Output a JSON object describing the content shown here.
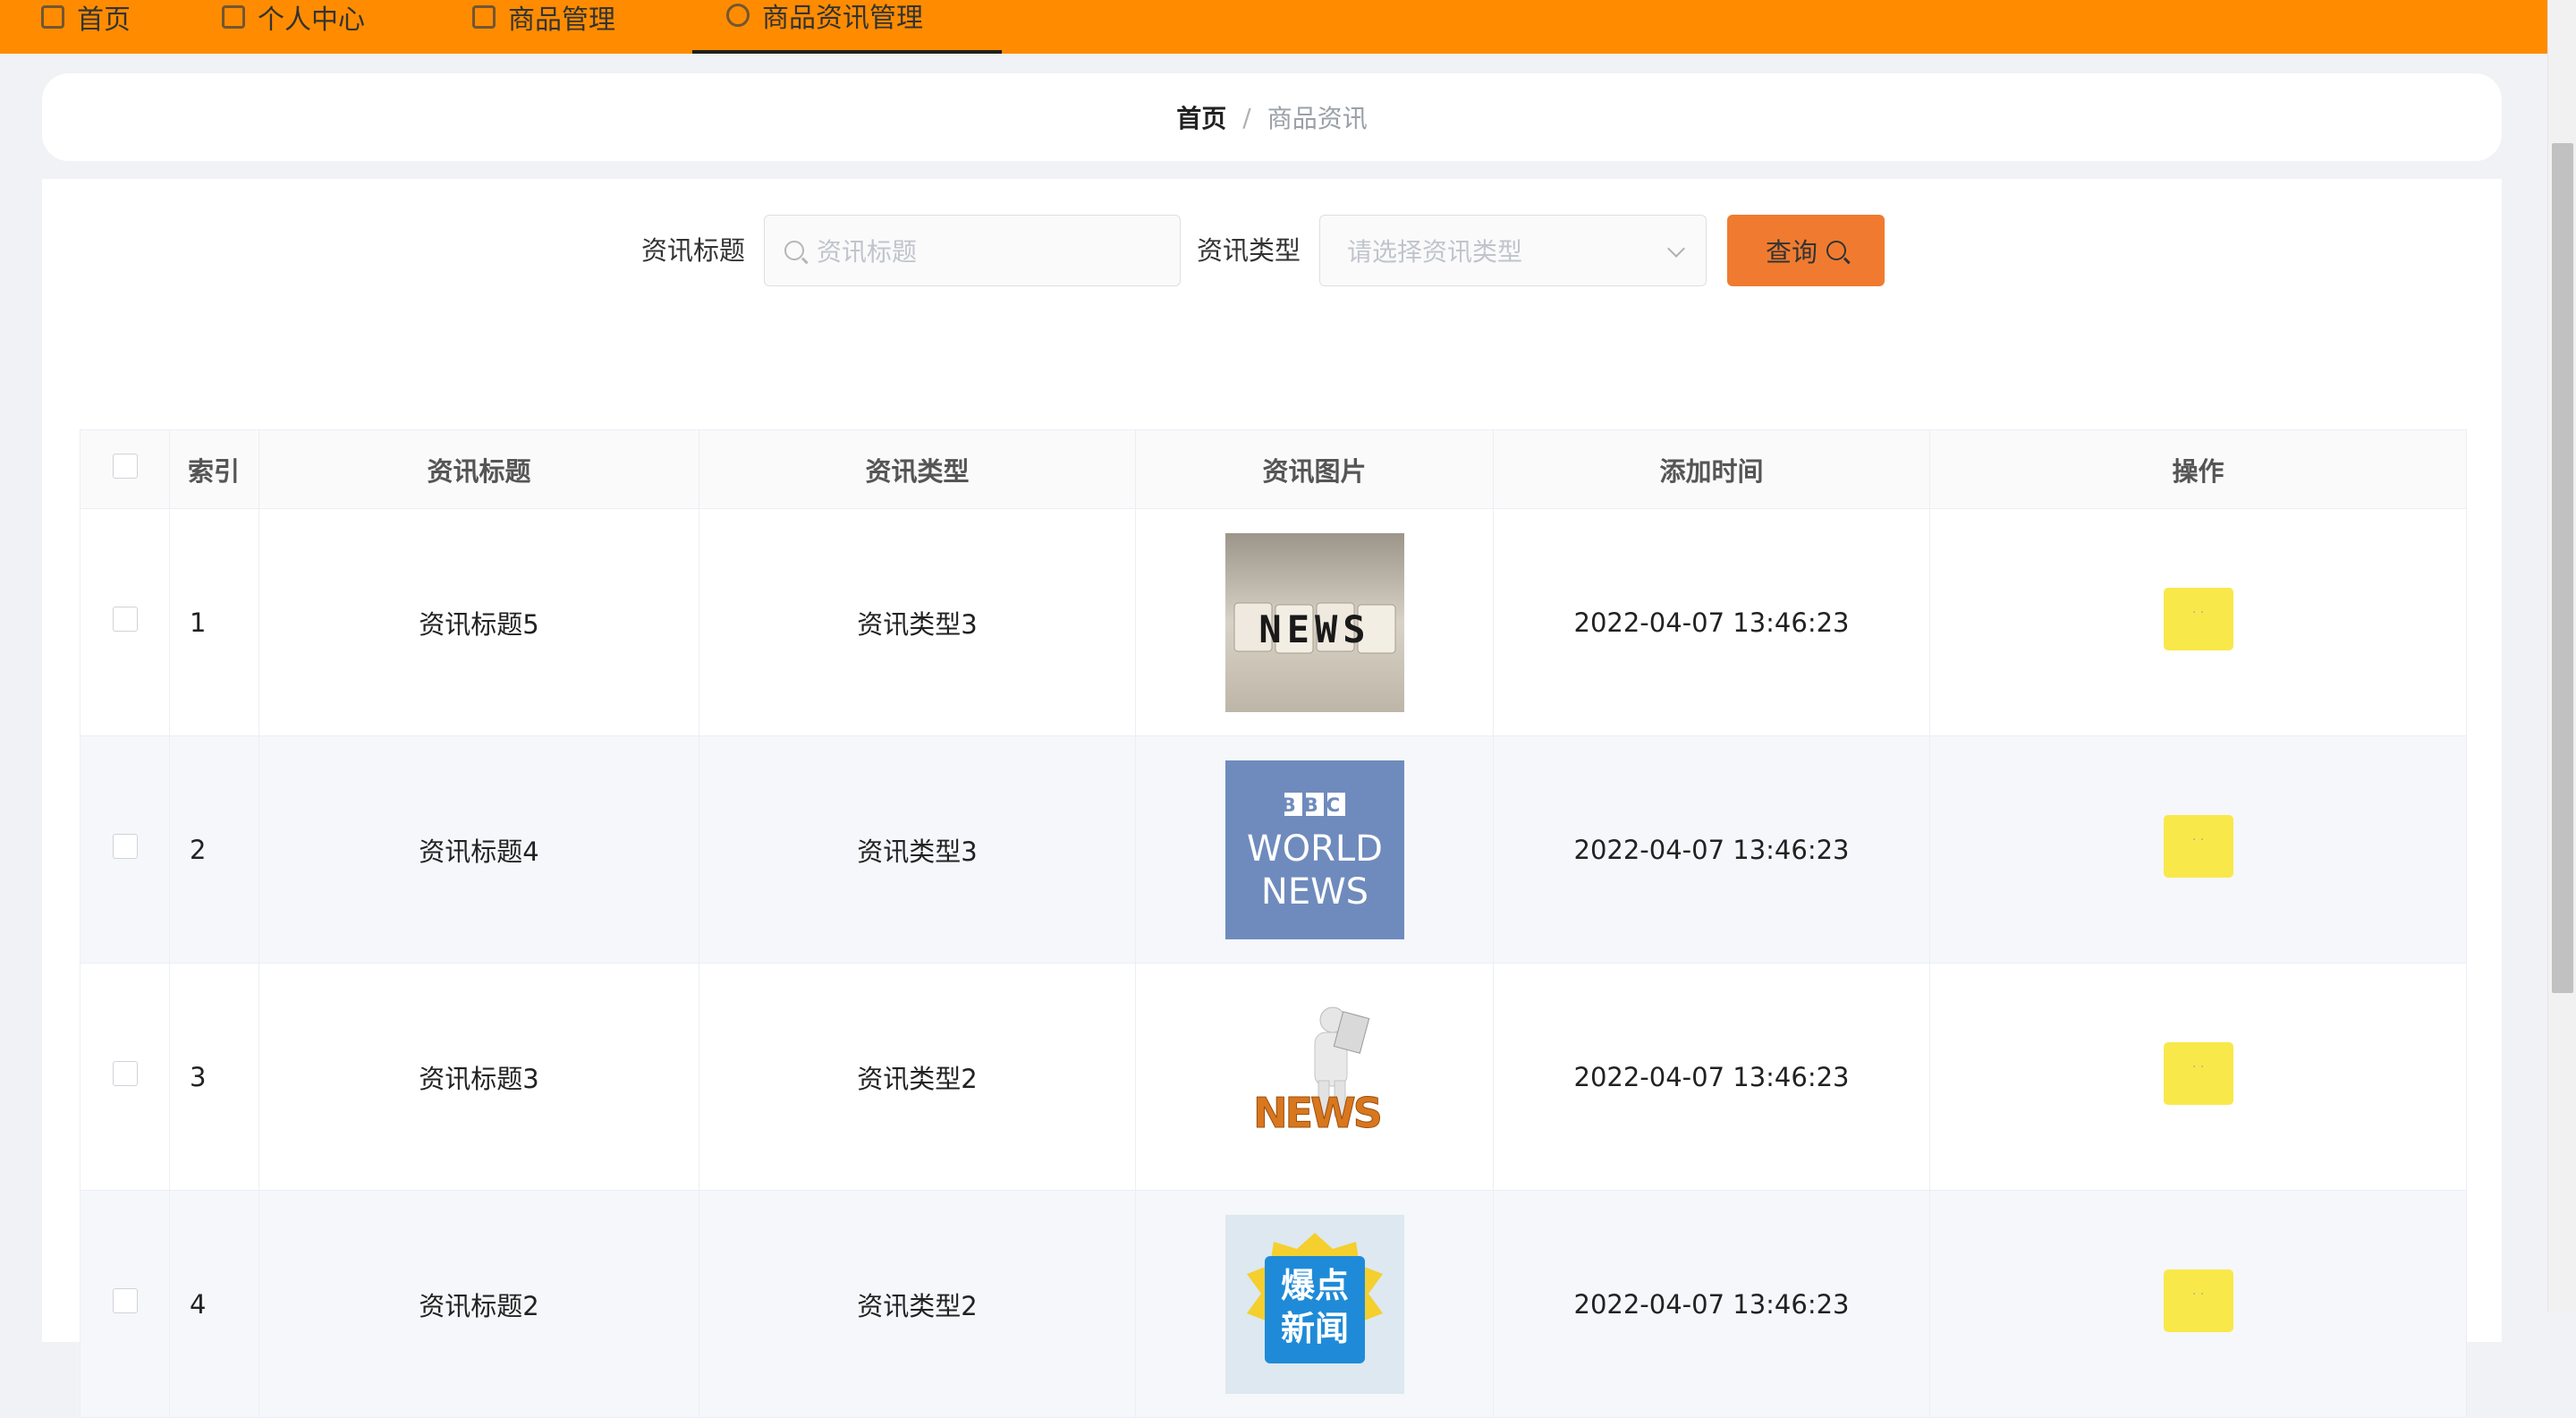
{
  "nav": {
    "items": [
      {
        "label": "首页"
      },
      {
        "label": "个人中心"
      },
      {
        "label": "商品管理"
      },
      {
        "label": "商品资讯管理"
      }
    ]
  },
  "breadcrumb": {
    "home": "首页",
    "separator": "/",
    "current": "商品资讯"
  },
  "search": {
    "title_label": "资讯标题",
    "title_placeholder": "资讯标题",
    "type_label": "资讯类型",
    "type_placeholder": "请选择资讯类型",
    "query_label": "查询"
  },
  "table": {
    "headers": {
      "index": "索引",
      "title": "资讯标题",
      "type": "资讯类型",
      "image": "资讯图片",
      "time": "添加时间",
      "action": "操作"
    },
    "rows": [
      {
        "index": "1",
        "title": "资讯标题5",
        "type": "资讯类型3",
        "image": "news-blocks-image",
        "time": "2022-04-07 13:46:23"
      },
      {
        "index": "2",
        "title": "资讯标题4",
        "type": "资讯类型3",
        "image": "bbc-world-news-image",
        "time": "2022-04-07 13:46:23"
      },
      {
        "index": "3",
        "title": "资讯标题3",
        "type": "资讯类型2",
        "image": "news-figure-image",
        "time": "2022-04-07 13:46:23"
      },
      {
        "index": "4",
        "title": "资讯标题2",
        "type": "资讯类型2",
        "image": "breaking-news-image",
        "time": "2022-04-07 13:46:23"
      }
    ]
  },
  "images": {
    "bbc_line1": "BBC",
    "bbc_line2": "WORLD",
    "bbc_line3": "NEWS",
    "news_blocks_text": "NEWS",
    "news_figure_text": "NEWS",
    "breaking_line1": "爆点",
    "breaking_line2": "新闻"
  },
  "colors": {
    "nav_bg": "#ff8c00",
    "query_button": "#f07b30",
    "op_button": "#f9e84a"
  }
}
